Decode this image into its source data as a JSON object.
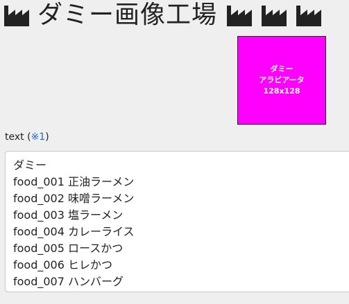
{
  "header": {
    "title": "ダミー画像工場",
    "icons": [
      "factory-icon",
      "factory-icon",
      "factory-icon",
      "factory-icon"
    ]
  },
  "preview": {
    "line1": "ダミー",
    "line2": "アラビアータ",
    "line3": "128x128",
    "background_color": "#ff00ff",
    "text_color": "#ffffff"
  },
  "text_field": {
    "label": "text",
    "note_open": " (",
    "note": "※1",
    "note_close": ")",
    "lines": [
      "ダミー",
      "food_001 正油ラーメン",
      "food_002 味噌ラーメン",
      "food_003 塩ラーメン",
      "food_004 カレーライス",
      "food_005 ロースかつ",
      "food_006 ヒレかつ",
      "food_007 ハンバーグ"
    ]
  },
  "colors": {
    "background": "#efefef",
    "text": "#222222",
    "link": "#1a6fd6"
  }
}
